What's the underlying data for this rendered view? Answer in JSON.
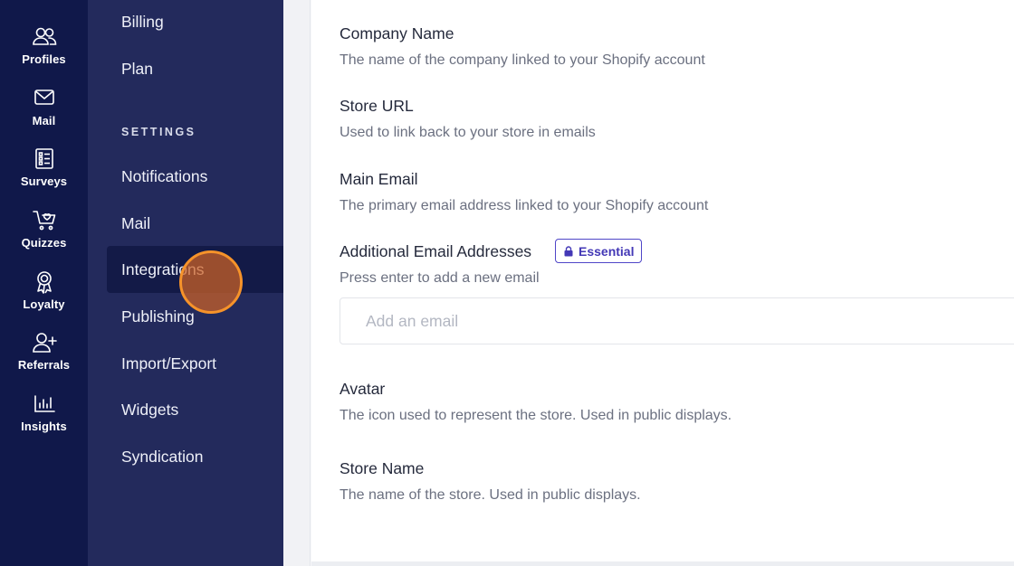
{
  "rail": {
    "items": [
      {
        "label": "Profiles",
        "icon": "users-icon"
      },
      {
        "label": "Mail",
        "icon": "envelope-icon"
      },
      {
        "label": "Surveys",
        "icon": "survey-list-icon"
      },
      {
        "label": "Quizzes",
        "icon": "cart-heart-icon"
      },
      {
        "label": "Loyalty",
        "icon": "award-ribbon-icon"
      },
      {
        "label": "Referrals",
        "icon": "user-plus-icon"
      },
      {
        "label": "Insights",
        "icon": "bar-chart-icon"
      }
    ]
  },
  "sidebar": {
    "items_top": [
      {
        "label": "Billing"
      },
      {
        "label": "Plan"
      }
    ],
    "settings_heading": "SETTINGS",
    "items": [
      {
        "label": "Notifications",
        "active": false
      },
      {
        "label": "Mail",
        "active": false
      },
      {
        "label": "Integrations",
        "active": true
      },
      {
        "label": "Publishing",
        "active": false
      },
      {
        "label": "Import/Export",
        "active": false
      },
      {
        "label": "Widgets",
        "active": false
      },
      {
        "label": "Syndication",
        "active": false
      }
    ]
  },
  "form": {
    "company_name": {
      "label": "Company Name",
      "description": "The name of the company linked to your Shopify account"
    },
    "store_url": {
      "label": "Store URL",
      "description": "Used to link back to your store in emails"
    },
    "main_email": {
      "label": "Main Email",
      "description": "The primary email address linked to your Shopify account"
    },
    "additional_emails": {
      "label": "Additional Email Addresses",
      "badge": "Essential",
      "badge_icon": "lock-icon",
      "description": "Press enter to add a new email",
      "placeholder": "Add an email",
      "value": ""
    },
    "avatar": {
      "label": "Avatar",
      "description": "The icon used to represent the store. Used in public displays."
    },
    "store_name": {
      "label": "Store Name",
      "description": "The name of the store. Used in public displays."
    }
  },
  "colors": {
    "rail_bg": "#10184a",
    "sidebar_bg": "#232a5c",
    "sidebar_active_bg": "#131a47",
    "badge_accent": "#4f46c8",
    "click_indicator": "#f6932a"
  }
}
